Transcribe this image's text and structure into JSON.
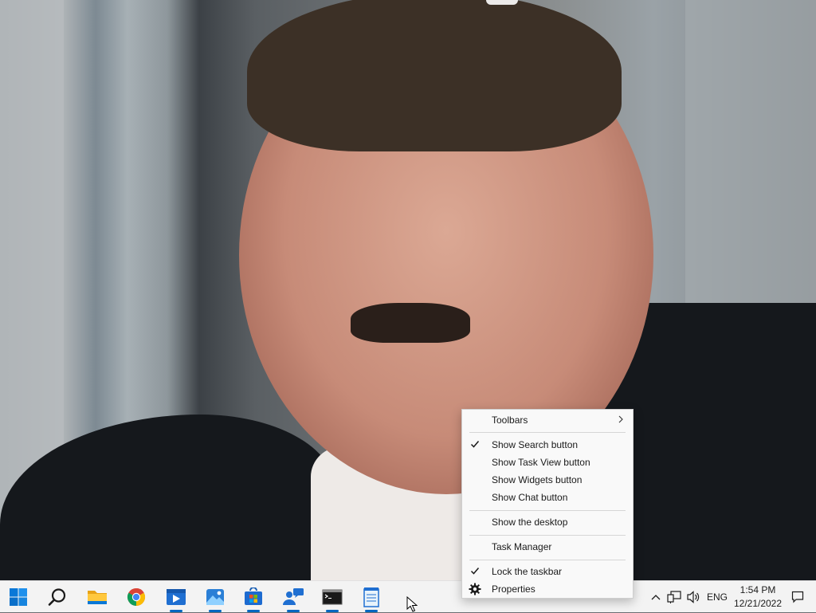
{
  "desktop": {
    "wallpaper": "photo-wallpaper"
  },
  "context_menu": {
    "items": [
      {
        "label": "Toolbars",
        "checked": false,
        "submenu": true
      },
      {
        "label": "Show Search button",
        "checked": true
      },
      {
        "label": "Show Task View button",
        "checked": false
      },
      {
        "label": "Show Widgets button",
        "checked": false
      },
      {
        "label": "Show Chat button",
        "checked": false
      },
      {
        "label": "Show the desktop",
        "checked": false
      },
      {
        "label": "Task Manager",
        "checked": false
      },
      {
        "label": "Lock the taskbar",
        "checked": true
      },
      {
        "label": "Properties",
        "icon": "gear-icon"
      }
    ]
  },
  "taskbar": {
    "apps": [
      {
        "name": "start",
        "icon": "windows-logo-icon",
        "running": false
      },
      {
        "name": "search",
        "icon": "search-icon",
        "running": false
      },
      {
        "name": "file-explorer",
        "icon": "folder-icon",
        "running": false
      },
      {
        "name": "chrome",
        "icon": "chrome-icon",
        "running": false
      },
      {
        "name": "media-player",
        "icon": "media-player-icon",
        "running": true
      },
      {
        "name": "photos",
        "icon": "photos-icon",
        "running": true
      },
      {
        "name": "store",
        "icon": "store-icon",
        "running": true
      },
      {
        "name": "remote-assistance",
        "icon": "chat-people-icon",
        "running": true
      },
      {
        "name": "command-prompt",
        "icon": "terminal-icon",
        "running": true
      },
      {
        "name": "notepad",
        "icon": "notepad-icon",
        "running": true
      }
    ],
    "tray": {
      "language": "ENG",
      "time": "1:54 PM",
      "date": "12/21/2022"
    }
  },
  "colors": {
    "accent": "#0067c0",
    "taskbar_bg": "#f3f3f3",
    "menu_bg": "#f9f9f9"
  }
}
